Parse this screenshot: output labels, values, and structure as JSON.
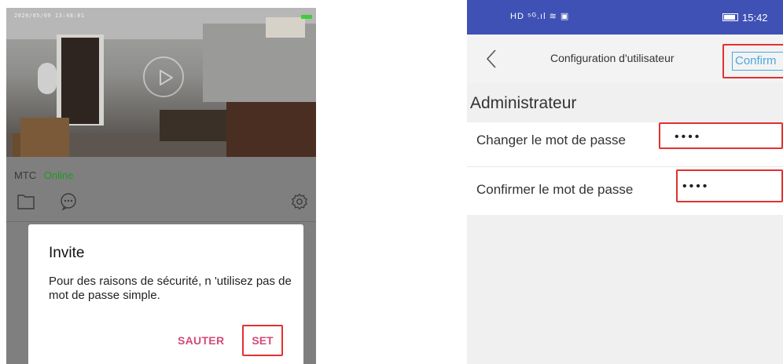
{
  "left_screen": {
    "camera": {
      "timestamp": "2020/05/09 13:48:01",
      "play_icon": "play-icon"
    },
    "device": {
      "name": "MTC",
      "status": "Online",
      "status_color": "#1e9a1e"
    },
    "toolbar": {
      "icons": [
        "folder-icon",
        "chat-icon",
        "gear-icon"
      ]
    },
    "dialog": {
      "title": "Invite",
      "message": "Pour des raisons de sécurité, n 'utilisez pas de mot de passe simple.",
      "skip_label": "SAUTER",
      "set_label": "SET",
      "accent_color": "#d24a7a"
    }
  },
  "right_screen": {
    "status_bar": {
      "left_icons": "HD ⁵ᴳ.ıl ≋ ▣",
      "time": "15:42",
      "color": "#3f51b5"
    },
    "nav": {
      "back_icon": "chevron-left-icon",
      "title": "Configuration d'utilisateur",
      "confirm_label": "Confirm",
      "confirm_color": "#4aa8e0"
    },
    "section": {
      "header": "Administrateur"
    },
    "form": {
      "new_password_label": "Changer le mot de passe",
      "new_password_value": "••••",
      "confirm_password_label": "Confirmer le mot de passe",
      "confirm_password_value": "••••"
    },
    "highlight_color": "#e23030"
  }
}
